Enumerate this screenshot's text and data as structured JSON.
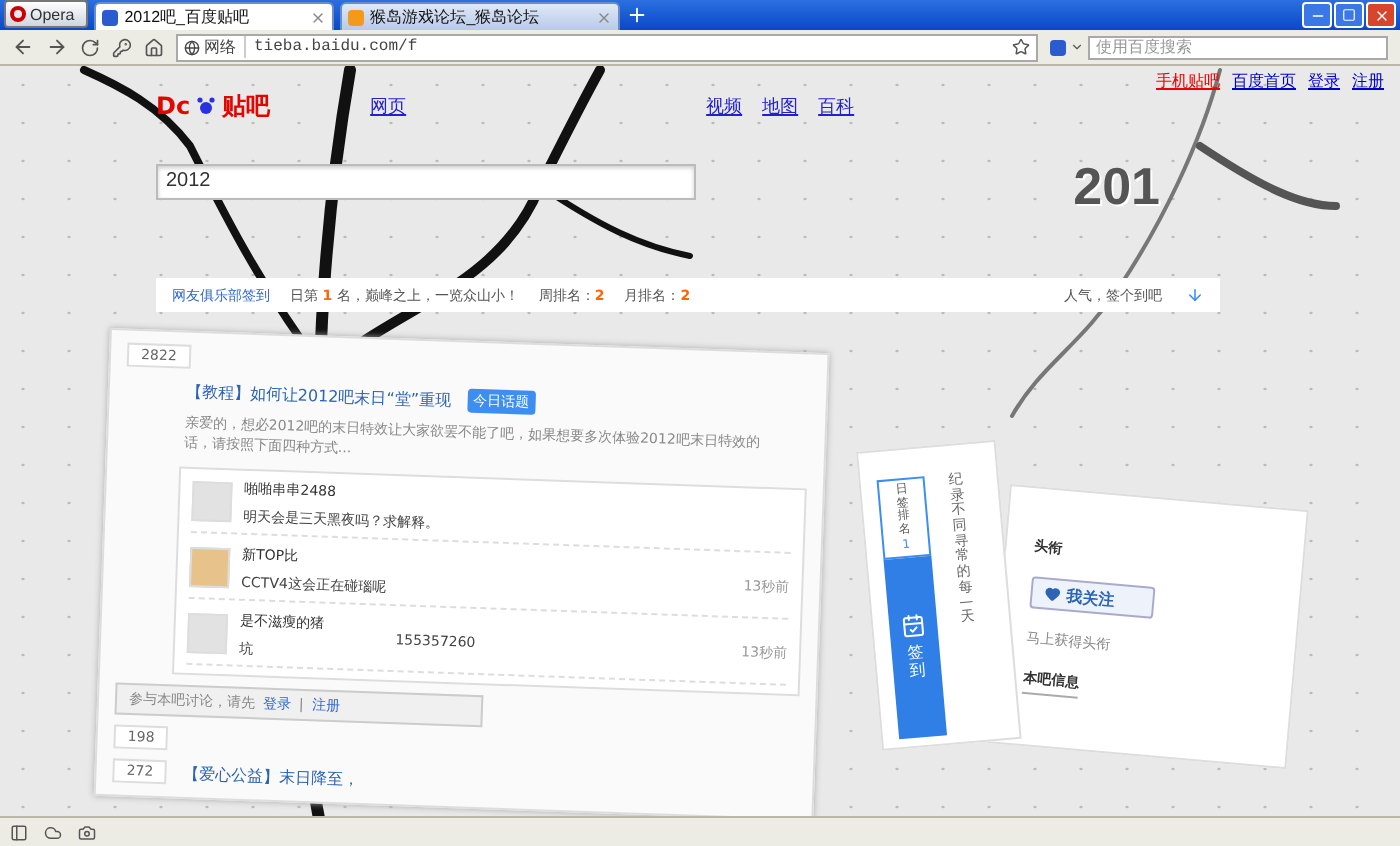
{
  "browser": {
    "menu_label": "Opera",
    "tabs": [
      {
        "title": "2012吧_百度贴吧",
        "selected": true
      },
      {
        "title": "猴岛游戏论坛_猴岛论坛",
        "selected": false
      }
    ],
    "address": {
      "badge": "网络",
      "url": "tieba.baidu.com/f"
    },
    "search": {
      "placeholder": "使用百度搜索"
    }
  },
  "top_links": [
    {
      "label": "手机贴吧",
      "highlight": true
    },
    {
      "label": "百度首页",
      "highlight": false
    },
    {
      "label": "登录",
      "highlight": false
    },
    {
      "label": "注册",
      "highlight": false
    }
  ],
  "logo": {
    "left": "Dc",
    "right": "贴吧"
  },
  "nav": [
    "网页",
    "视频",
    "地图",
    "百科"
  ],
  "search_box": {
    "value": "2012"
  },
  "banner": {
    "text": "201"
  },
  "sign_bar": {
    "club": "网友俱乐部签到",
    "rank_prefix": "日第",
    "rank": "1",
    "rank_suffix": "名，巅峰之上，一览众山小！",
    "week_label": "周排名：",
    "week": "2",
    "month_label": "月排名：",
    "month": "2",
    "cta": "人气，签个到吧"
  },
  "thread_card": {
    "threads": [
      {
        "replies": "2822",
        "tag": "【教程】",
        "title": "如何让2012吧末日“堂”重现",
        "badge": "今日话题",
        "preview": "亲爱的，想必2012吧的末日特效让大家欲罢不能了吧，如果想要多次体验2012吧末日特效的话，请按照下面四种方式..."
      }
    ],
    "posts": [
      {
        "user": "啪啪串串2488",
        "text": "明天会是三天黑夜吗？求解释。",
        "kind": "blank"
      },
      {
        "user": "新TOP比",
        "text": "CCTV4这会正在碰瑙呢",
        "kind": "picture"
      },
      {
        "user": "是不滋瘦的猪",
        "text": "坑",
        "kind": "blank"
      }
    ],
    "number": "155357260",
    "times": [
      "13秒前",
      "13秒前"
    ],
    "login": {
      "prompt": "参与本吧讨论，请先",
      "login": "登录",
      "separator": "|",
      "register": "注册"
    },
    "more_threads": [
      {
        "replies": "198"
      },
      {
        "replies": "272",
        "tag": "【爱心公益】",
        "title": "末日降至，"
      }
    ]
  },
  "title_card": {
    "heading": "头衔",
    "follow": "我关注",
    "hint": "马上获得头衔",
    "info": "本吧信息"
  },
  "sign_card": {
    "rank_label": "日签排名",
    "rank": "1",
    "button": "签到",
    "slogan": "纪录不同寻常的每一天"
  }
}
